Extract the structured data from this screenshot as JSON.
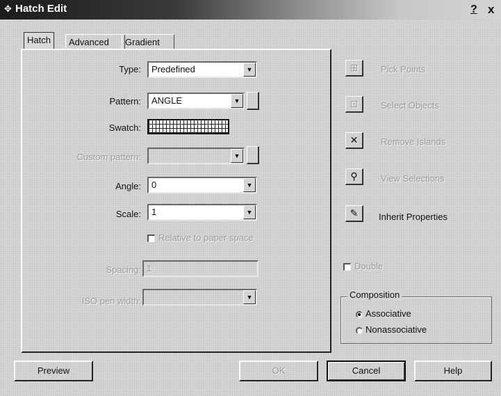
{
  "window": {
    "title": "Hatch Edit",
    "help_glyph": "?",
    "close_glyph": "x"
  },
  "tabs": [
    {
      "label": "Hatch",
      "active": true
    },
    {
      "label": "Advanced",
      "active": false
    },
    {
      "label": "Gradient",
      "active": false
    }
  ],
  "form": {
    "type": {
      "label": "Type:",
      "value": "Predefined"
    },
    "pattern": {
      "label": "Pattern:",
      "value": "ANGLE"
    },
    "swatch": {
      "label": "Swatch:"
    },
    "custom_pattern": {
      "label": "Custom pattern:",
      "value": ""
    },
    "angle": {
      "label": "Angle:",
      "value": "0"
    },
    "scale": {
      "label": "Scale:",
      "value": "1"
    },
    "relative": {
      "label": "Relative to paper space",
      "checked": false
    },
    "spacing": {
      "label": "Spacing:",
      "value": "1"
    },
    "iso_pen_width": {
      "label": "ISO pen width:",
      "value": ""
    }
  },
  "actions": [
    {
      "label": "Pick Points",
      "icon": "pick-points-icon",
      "enabled": false
    },
    {
      "label": "Select Objects",
      "icon": "select-objects-icon",
      "enabled": false
    },
    {
      "label": "Remove Islands",
      "icon": "remove-islands-icon",
      "enabled": false
    },
    {
      "label": "View Selections",
      "icon": "view-selections-icon",
      "enabled": false
    },
    {
      "label": "Inherit Properties",
      "icon": "inherit-properties-icon",
      "enabled": true
    }
  ],
  "double": {
    "label": "Double",
    "checked": false
  },
  "composition": {
    "title": "Composition",
    "options": [
      {
        "label": "Associative",
        "selected": true
      },
      {
        "label": "Nonassociative",
        "selected": false
      }
    ]
  },
  "buttons": {
    "preview": "Preview",
    "ok": "OK",
    "cancel": "Cancel",
    "help": "Help"
  },
  "colors": {
    "titlebar": "#1b1b1b",
    "background": "#d4d4d4",
    "disabled_text": "#9a9a9a"
  }
}
